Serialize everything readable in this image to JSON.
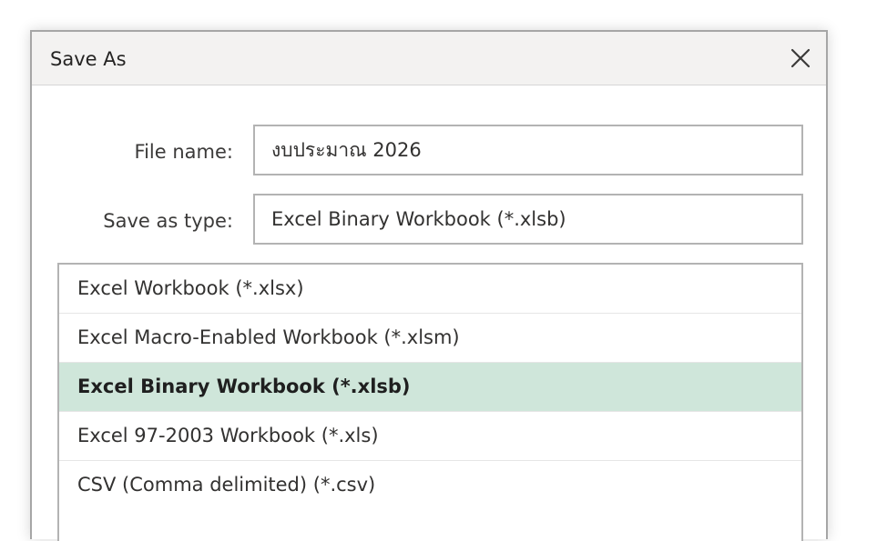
{
  "dialog": {
    "title": "Save As"
  },
  "form": {
    "file_name_label": "File name:",
    "file_name_value": "งบประมาณ 2026",
    "save_type_label": "Save as type:",
    "save_type_value": "Excel Binary Workbook (*.xlsb)"
  },
  "type_list": {
    "selected_index": 2,
    "options": [
      "Excel Workbook (*.xlsx)",
      "Excel Macro-Enabled Workbook (*.xlsm)",
      "Excel Binary Workbook (*.xlsb)",
      "Excel 97-2003 Workbook (*.xls)",
      "CSV (Comma delimited) (*.csv)"
    ]
  },
  "colors": {
    "selected_row": "#cfe6da",
    "title_bar": "#f3f2f1",
    "border": "#b3b3b3"
  },
  "icons": {
    "close": "close-icon"
  }
}
